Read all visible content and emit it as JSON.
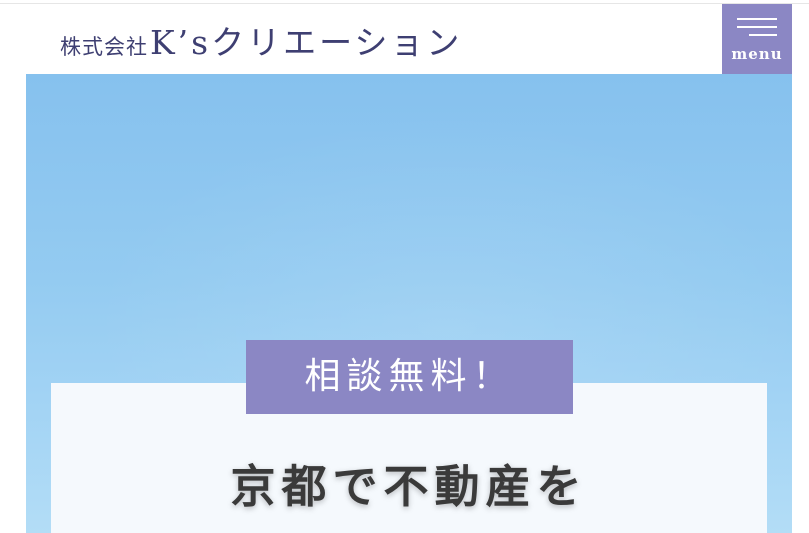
{
  "header": {
    "logo_prefix": "株式会社",
    "logo_name": "K’sクリエーション",
    "menu_label": "menu"
  },
  "hero": {
    "badge": "相談無料！",
    "headline": "京都で不動産を"
  },
  "colors": {
    "brand_purple": "#8b87c4",
    "logo_navy": "#3e3f72",
    "sky_top": "#86c1ee",
    "sky_bottom": "#b3ddf6",
    "card_bg": "#f5f9fd",
    "headline_text": "#3a3a3a"
  },
  "icons": {
    "menu": "hamburger-icon"
  }
}
